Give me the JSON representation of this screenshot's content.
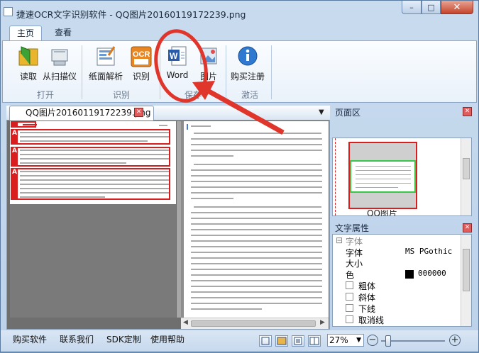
{
  "window": {
    "title": "捷速OCR文字识别软件 - QQ图片20160119172239.png",
    "min": "–",
    "max": "□",
    "close": "✕"
  },
  "tabs": [
    {
      "label": "主页"
    },
    {
      "label": "查看"
    }
  ],
  "ribbon": {
    "buttons": {
      "read": "读取",
      "scan": "从扫描仪",
      "layout": "纸面解析",
      "recognize": "识别",
      "word": "Word",
      "image": "图片",
      "buy": "购买注册"
    },
    "groups": {
      "open": "打开",
      "recognize": "识别",
      "save": "保存",
      "activate": "激活"
    }
  },
  "document": {
    "tab_label": "QQ图片20160119172239.png"
  },
  "page_area": {
    "title": "页面区",
    "thumb_label": "QQ图片"
  },
  "text_props": {
    "title": "文字属性",
    "section": "字体",
    "rows": [
      {
        "key": "字体",
        "value": "MS PGothic"
      },
      {
        "key": "大小",
        "value": ""
      },
      {
        "key": "色",
        "value": "000000"
      }
    ],
    "checks": [
      "粗体",
      "斜体",
      "下线",
      "取消线"
    ]
  },
  "statusbar": {
    "links": [
      "购买软件",
      "联系我们",
      "SDK定制",
      "使用帮助"
    ],
    "zoom": "27%"
  },
  "colors": {
    "accent_red": "#d81e1e",
    "annotation_red": "#e0352b",
    "thumb_green": "#37c84a"
  }
}
